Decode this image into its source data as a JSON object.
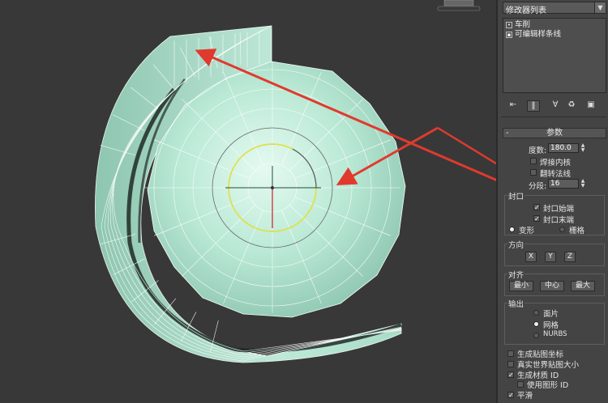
{
  "viewport": {
    "icons": [
      "viewcube-icon"
    ],
    "colors": {
      "mesh": "#aee6d0",
      "wire": "#ffffff",
      "arrow": "#e03a2e",
      "gizmo_circle": "#e8e23a"
    }
  },
  "modifier_panel": {
    "list_dropdown": "修改器列表",
    "stack": [
      {
        "icon": "bulb-icon",
        "label": "车削"
      },
      {
        "icon": "square-icon",
        "label": "可编辑样条线"
      }
    ],
    "toolbar_icons": [
      "pin-stack-icon",
      "show-end-result-icon",
      "make-unique-icon",
      "remove-modifier-icon",
      "configure-sets-icon"
    ]
  },
  "parameters": {
    "title": "参数",
    "collapse": "-",
    "degrees_label": "度数:",
    "degrees_value": "180.0",
    "weld_core": "焊接内核",
    "flip_normals": "翻转法线",
    "segments_label": "分段:",
    "segments_value": "16",
    "capping": {
      "title": "封口",
      "cap_start": "封口始端",
      "cap_end": "封口末端",
      "morph": "变形",
      "grid": "栅格"
    },
    "direction": {
      "title": "方向",
      "x": "X",
      "y": "Y",
      "z": "Z"
    },
    "align": {
      "title": "对齐",
      "min": "最小",
      "center": "中心",
      "max": "最大"
    },
    "output": {
      "title": "输出",
      "patch": "面片",
      "mesh": "网格",
      "nurbs": "NURBS"
    },
    "gen_map_coords": "生成贴图坐标",
    "real_world_map": "真实世界贴图大小",
    "gen_mat_ids": "生成材质 ID",
    "use_shape_ids": "使用图形 ID",
    "smooth": "平滑"
  }
}
